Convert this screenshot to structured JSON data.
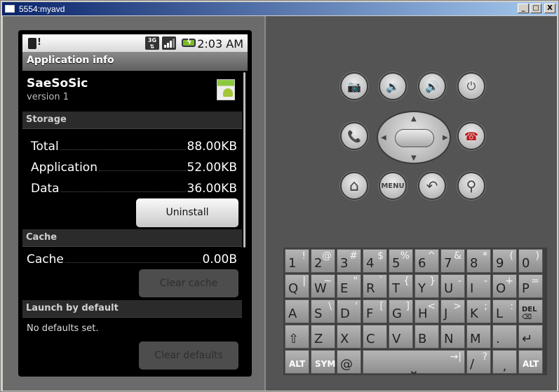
{
  "window": {
    "title": "5554:myavd",
    "buttons": {
      "minimize": "_",
      "maximize": "□",
      "close": "X"
    }
  },
  "statusbar": {
    "network": "3G",
    "time": "2:03 AM",
    "icons": [
      "sd-card-warning-icon",
      "3g-data-icon",
      "signal-icon",
      "battery-charging-icon"
    ]
  },
  "screen": {
    "title": "Application info",
    "app": {
      "name": "SaeSoSic",
      "version": "version 1",
      "icon": "android-app-icon"
    },
    "storage": {
      "header": "Storage",
      "rows": [
        {
          "label": "Total",
          "value": "88.00KB"
        },
        {
          "label": "Application",
          "value": "52.00KB"
        },
        {
          "label": "Data",
          "value": "36.00KB"
        }
      ],
      "uninstall_label": "Uninstall"
    },
    "cache": {
      "header": "Cache",
      "row": {
        "label": "Cache",
        "value": "0.00B"
      },
      "clear_label": "Clear cache"
    },
    "launch": {
      "header": "Launch by default",
      "text": "No defaults set.",
      "clear_label": "Clear defaults"
    }
  },
  "hardware": {
    "top_row": [
      "camera-icon",
      "volume-down-icon",
      "volume-up-icon",
      "power-icon"
    ],
    "mid_row": [
      "call-icon",
      "dpad",
      "end-call-icon"
    ],
    "bottom_row": [
      "home-icon",
      "menu-button",
      "back-icon",
      "search-icon"
    ],
    "menu_label": "MENU",
    "glyphs": {
      "camera": "📷",
      "voldown": "🔉",
      "volup": "🔊",
      "power": "⏻",
      "call": "📞",
      "endcall": "☎",
      "home": "⌂",
      "back": "↶",
      "search": "⚲"
    }
  },
  "keyboard": {
    "rows": [
      [
        {
          "m": "1",
          "a": "!"
        },
        {
          "m": "2",
          "a": "@"
        },
        {
          "m": "3",
          "a": "#"
        },
        {
          "m": "4",
          "a": "$"
        },
        {
          "m": "5",
          "a": "%"
        },
        {
          "m": "6",
          "a": "^"
        },
        {
          "m": "7",
          "a": "&"
        },
        {
          "m": "8",
          "a": "*"
        },
        {
          "m": "9",
          "a": "("
        },
        {
          "m": "0",
          "a": ")"
        }
      ],
      [
        {
          "m": "Q",
          "a": "|"
        },
        {
          "m": "W",
          "a": "~"
        },
        {
          "m": "E",
          "a": "\""
        },
        {
          "m": "R",
          "a": "`"
        },
        {
          "m": "T",
          "a": "{"
        },
        {
          "m": "Y",
          "a": "}"
        },
        {
          "m": "U",
          "a": "-"
        },
        {
          "m": "I",
          "a": "-"
        },
        {
          "m": "O",
          "a": "+"
        },
        {
          "m": "P",
          "a": "="
        }
      ],
      [
        {
          "m": "A",
          "a": ""
        },
        {
          "m": "S",
          "a": "\\"
        },
        {
          "m": "D",
          "a": "'"
        },
        {
          "m": "F",
          "a": "["
        },
        {
          "m": "G",
          "a": "]"
        },
        {
          "m": "H",
          "a": "<"
        },
        {
          "m": "J",
          "a": ">"
        },
        {
          "m": "K",
          "a": ";"
        },
        {
          "m": "L",
          "a": ":"
        },
        {
          "m": "DEL ⌫",
          "a": ""
        }
      ],
      [
        {
          "m": "⇧",
          "a": ""
        },
        {
          "m": "Z",
          "a": ""
        },
        {
          "m": "X",
          "a": ""
        },
        {
          "m": "C",
          "a": ""
        },
        {
          "m": "V",
          "a": ""
        },
        {
          "m": "B",
          "a": ""
        },
        {
          "m": "N",
          "a": ""
        },
        {
          "m": "M",
          "a": ""
        },
        {
          "m": ".",
          "a": ""
        },
        {
          "m": "↵",
          "a": ""
        }
      ]
    ],
    "last_row": {
      "alt_left": "ALT",
      "sym": "SYM",
      "at": "@",
      "space": "⎵",
      "tab": "→|",
      "slash": "/",
      "question": "?",
      "comma": ",",
      "alt_right": "ALT"
    }
  }
}
